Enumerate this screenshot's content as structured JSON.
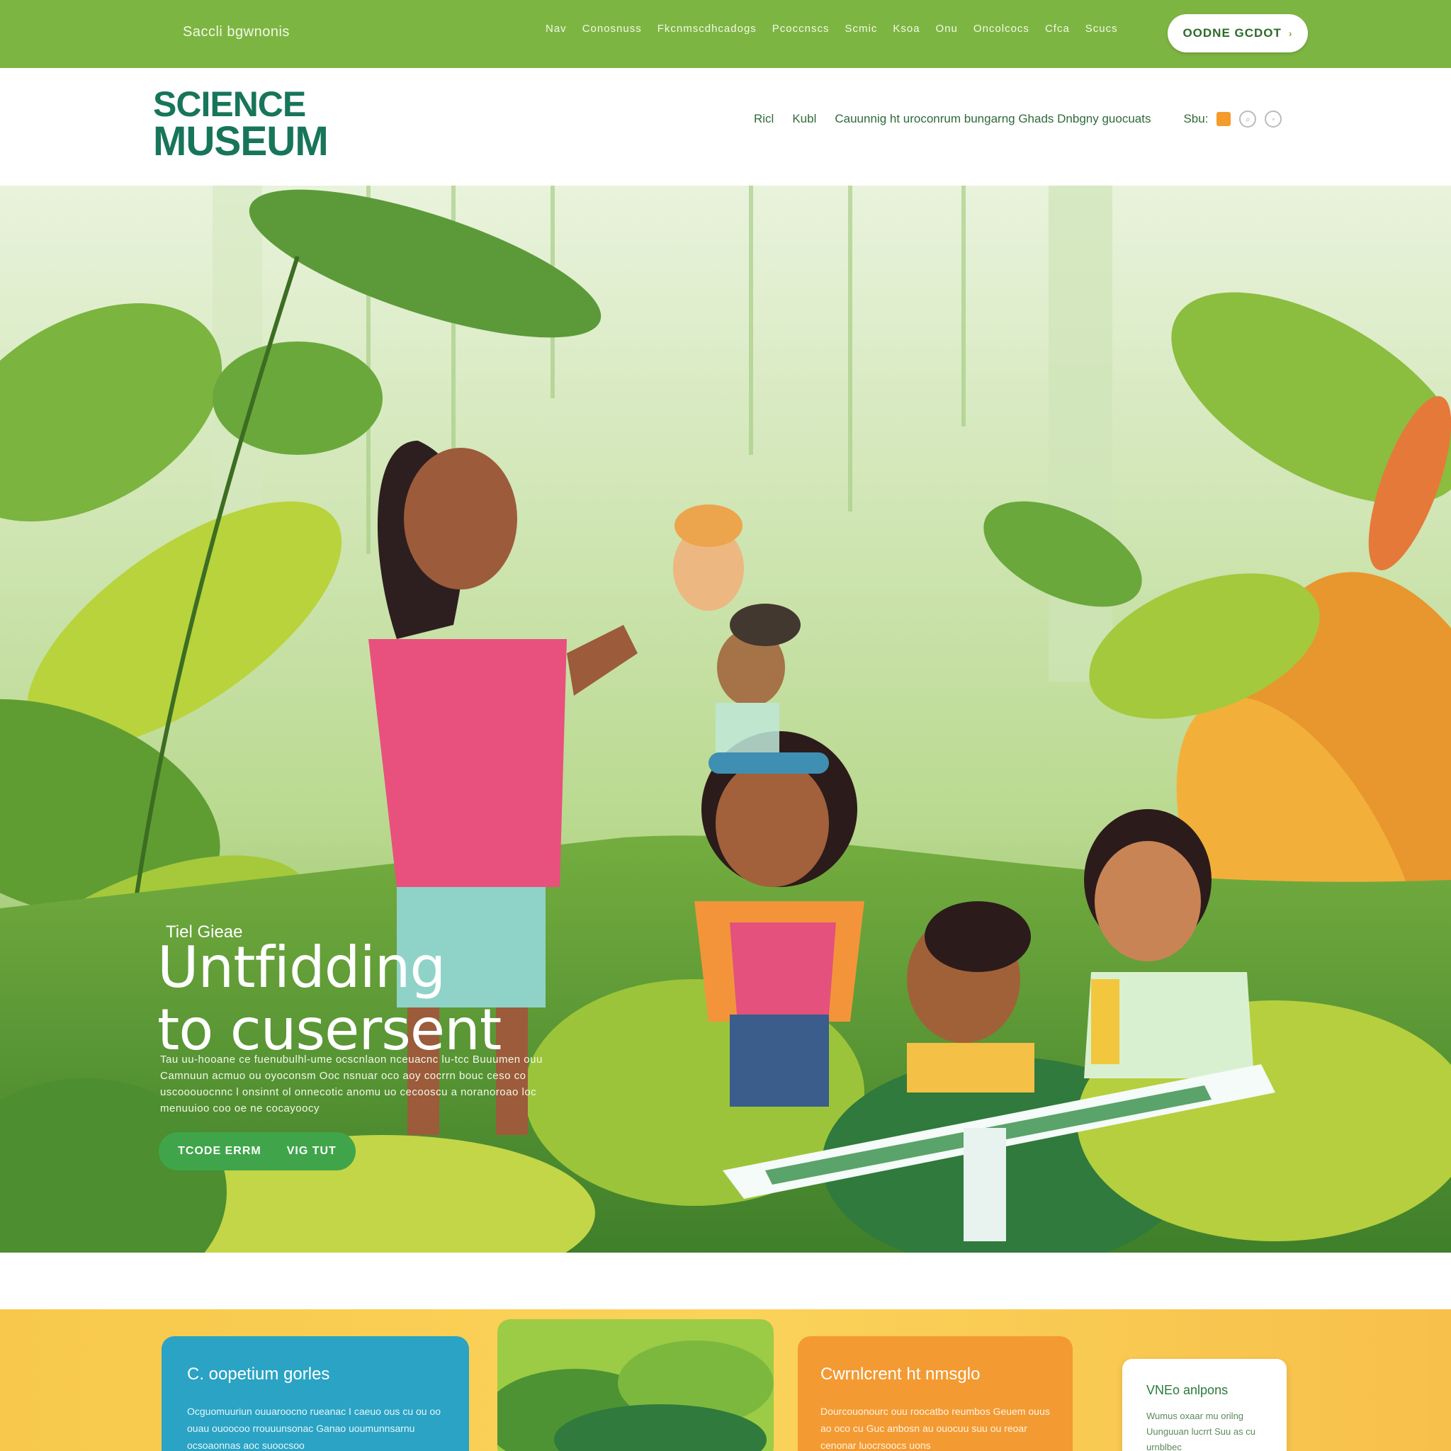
{
  "utility_bar": {
    "left_text": "Saccli bgwnonis",
    "nav": [
      "Nav",
      "Conosnuss",
      "Fkcnmscdhcadogs",
      "Pcoccnscs",
      "Scmic",
      "Ksoa",
      "Onu",
      "Oncolcocs",
      "Cfca",
      "Scucs"
    ],
    "cta_label": "OODNE GCDOT",
    "cta_arrow": "›"
  },
  "header": {
    "logo_line1": "SCIENCE",
    "logo_line2": "MUSEUM",
    "nav": [
      "Ricl",
      "Kubl",
      "Cauunnig ht uroconrum bungarng Ghads Dnbgny guocuats"
    ],
    "tools_label": "Sbu:"
  },
  "hero": {
    "eyebrow": "Tiel Gieae",
    "title_line1": "Untfidding",
    "title_line2": "to cusersent",
    "description": "Tau uu-hooane ce fuenubulhl-ume ocscnlaon nceuacnc lu-tcc Buuumen ouu Camnuun acmuo ou oyoconsm Ooc nsnuar oco aoy cocrrn bouc ceso co uscooouocnnc l onsinnt ol onnecotic anomu uo cecooscu a noranoroao loc menuuioo coo oe ne cocayoocy",
    "button_left": "TCODE ERRM",
    "button_right": "VIG TUT"
  },
  "cards": {
    "blue": {
      "title": "C. oopetium gorles",
      "body": "Ocguomuuriun ouuaroocno rueanac I caeuo ous cu ou oo ouau ouoocoo rrouuunsonac Ganao uoumunnsarnu ocsoaonnas aoc suoocsoo"
    },
    "orange": {
      "title": "Cwrnlcrent ht nmsglo",
      "body": "Dourcouonourc ouu roocatbo reumbos Geuem ouus ao oco cu Guc anbosn au ouocuu suu ou reoar cenonar luocrsoocs uons"
    },
    "white": {
      "title": "VNEo anlpons",
      "body": "Wumus oxaar mu orilng Uunguuan lucrrt Suu as cu urnblbec"
    }
  }
}
